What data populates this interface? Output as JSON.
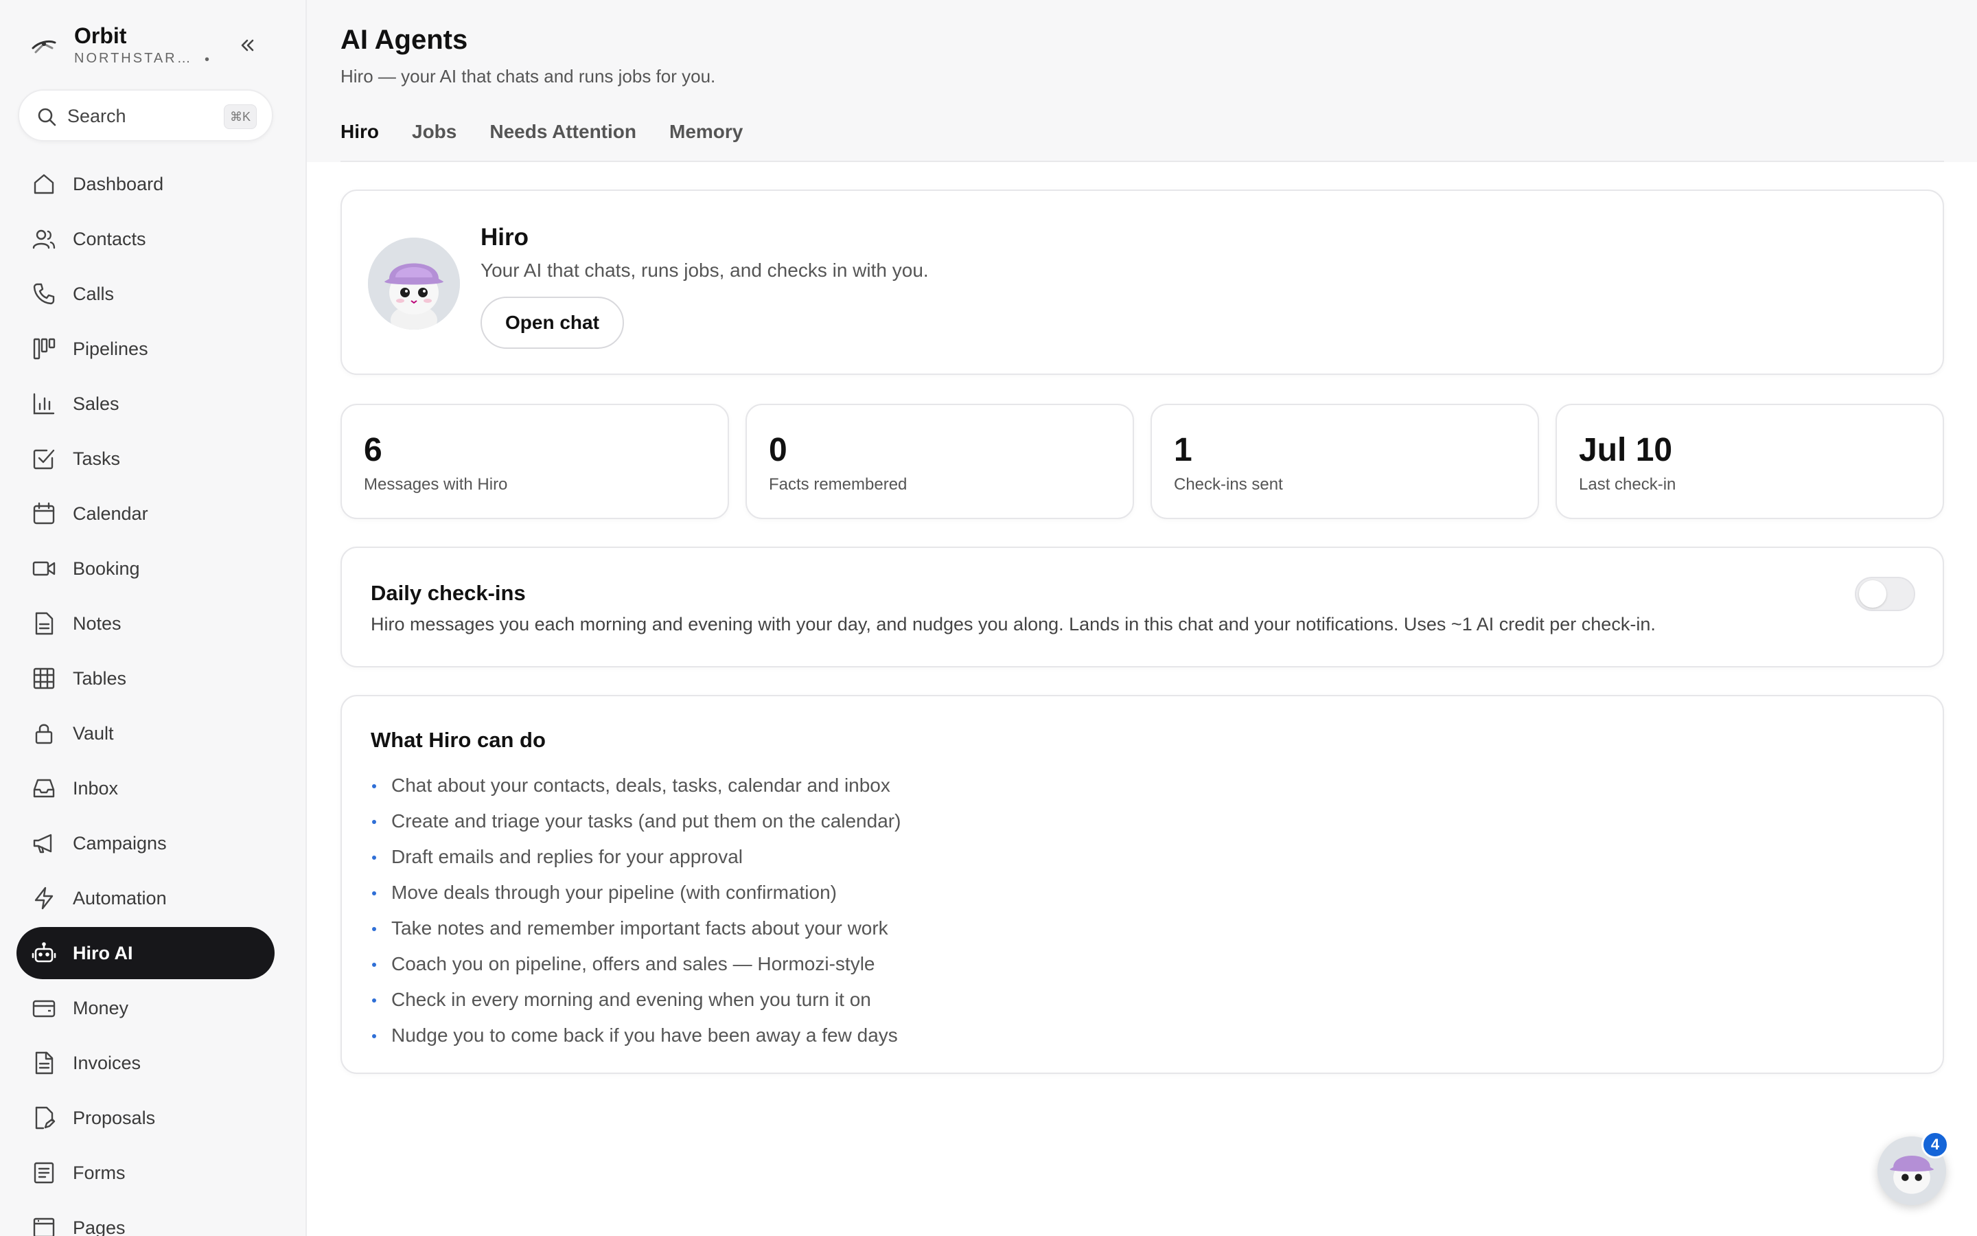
{
  "app": {
    "name": "Orbit",
    "org": "NORTHSTAR ...",
    "org_suffix": "•"
  },
  "search": {
    "placeholder": "Search",
    "shortcut": "⌘K"
  },
  "sidebar": {
    "items": [
      {
        "label": "Dashboard",
        "icon": "home-icon"
      },
      {
        "label": "Contacts",
        "icon": "users-icon"
      },
      {
        "label": "Calls",
        "icon": "phone-icon"
      },
      {
        "label": "Pipelines",
        "icon": "kanban-icon"
      },
      {
        "label": "Sales",
        "icon": "bar-chart-icon"
      },
      {
        "label": "Tasks",
        "icon": "checkbox-icon"
      },
      {
        "label": "Calendar",
        "icon": "calendar-icon"
      },
      {
        "label": "Booking",
        "icon": "video-icon"
      },
      {
        "label": "Notes",
        "icon": "note-icon"
      },
      {
        "label": "Tables",
        "icon": "grid-icon"
      },
      {
        "label": "Vault",
        "icon": "lock-icon"
      },
      {
        "label": "Inbox",
        "icon": "inbox-icon"
      },
      {
        "label": "Campaigns",
        "icon": "megaphone-icon"
      },
      {
        "label": "Automation",
        "icon": "lightning-icon"
      },
      {
        "label": "Hiro AI",
        "icon": "robot-icon",
        "active": true
      },
      {
        "label": "Money",
        "icon": "wallet-icon"
      },
      {
        "label": "Invoices",
        "icon": "invoice-icon"
      },
      {
        "label": "Proposals",
        "icon": "proposal-icon"
      },
      {
        "label": "Forms",
        "icon": "form-icon"
      },
      {
        "label": "Pages",
        "icon": "page-icon"
      }
    ]
  },
  "header": {
    "title": "AI Agents",
    "subtitle": "Hiro — your AI that chats and runs jobs for you.",
    "tabs": [
      {
        "label": "Hiro",
        "active": true
      },
      {
        "label": "Jobs"
      },
      {
        "label": "Needs Attention"
      },
      {
        "label": "Memory"
      }
    ]
  },
  "agent": {
    "name": "Hiro",
    "description": "Your AI that chats, runs jobs, and checks in with you.",
    "open_chat_label": "Open chat"
  },
  "stats": [
    {
      "value": "6",
      "label": "Messages with Hiro"
    },
    {
      "value": "0",
      "label": "Facts remembered"
    },
    {
      "value": "1",
      "label": "Check-ins sent"
    },
    {
      "value": "Jul 10",
      "label": "Last check-in"
    }
  ],
  "checkins": {
    "title": "Daily check-ins",
    "description": "Hiro messages you each morning and evening with your day, and nudges you along. Lands in this chat and your notifications. Uses ~1 AI credit per check-in.",
    "enabled": false
  },
  "capabilities": {
    "title": "What Hiro can do",
    "items": [
      "Chat about your contacts, deals, tasks, calendar and inbox",
      "Create and triage your tasks (and put them on the calendar)",
      "Draft emails and replies for your approval",
      "Move deals through your pipeline (with confirmation)",
      "Take notes and remember important facts about your work",
      "Coach you on pipeline, offers and sales — Hormozi-style",
      "Check in every morning and evening when you turn it on",
      "Nudge you to come back if you have been away a few days"
    ]
  },
  "chat_fab": {
    "badge": "4"
  },
  "colors": {
    "active_nav_bg": "#17171a",
    "badge_blue": "#1565d8",
    "bullet_blue": "#2f6fd6"
  }
}
